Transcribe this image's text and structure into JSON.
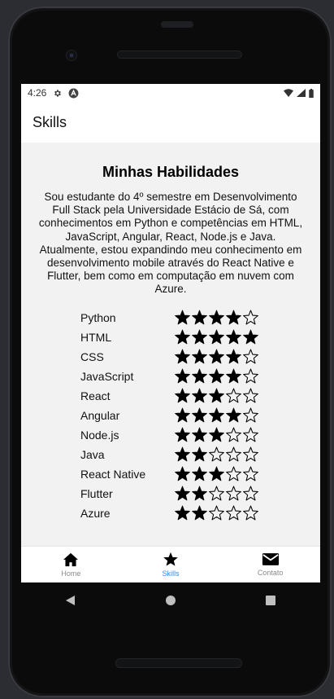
{
  "status_bar": {
    "time": "4:26"
  },
  "app_bar": {
    "title": "Skills"
  },
  "main": {
    "heading": "Minhas Habilidades",
    "description": "Sou estudante do 4º semestre em Desenvolvimento Full Stack pela Universidade Estácio de Sá, com conhecimentos em Python e competências em HTML, JavaScript, Angular, React, Node.js e Java. Atualmente, estou expandindo meu conhecimento em desenvolvimento mobile através do React Native e Flutter, bem como em computação em nuvem com Azure."
  },
  "skills": [
    {
      "name": "Python",
      "rating": 4,
      "max": 5
    },
    {
      "name": "HTML",
      "rating": 5,
      "max": 5
    },
    {
      "name": "CSS",
      "rating": 4,
      "max": 5
    },
    {
      "name": "JavaScript",
      "rating": 4,
      "max": 5
    },
    {
      "name": "React",
      "rating": 3,
      "max": 5
    },
    {
      "name": "Angular",
      "rating": 4,
      "max": 5
    },
    {
      "name": "Node.js",
      "rating": 3,
      "max": 5
    },
    {
      "name": "Java",
      "rating": 2,
      "max": 5
    },
    {
      "name": "React Native",
      "rating": 3,
      "max": 5
    },
    {
      "name": "Flutter",
      "rating": 2,
      "max": 5
    },
    {
      "name": "Azure",
      "rating": 2,
      "max": 5
    }
  ],
  "tabs": [
    {
      "label": "Home",
      "icon": "home-icon",
      "active": false
    },
    {
      "label": "Skills",
      "icon": "star-icon",
      "active": true
    },
    {
      "label": "Contato",
      "icon": "mail-icon",
      "active": false
    }
  ],
  "colors": {
    "active_tab": "#2f8de4",
    "inactive_tab": "#8a8a8a"
  }
}
